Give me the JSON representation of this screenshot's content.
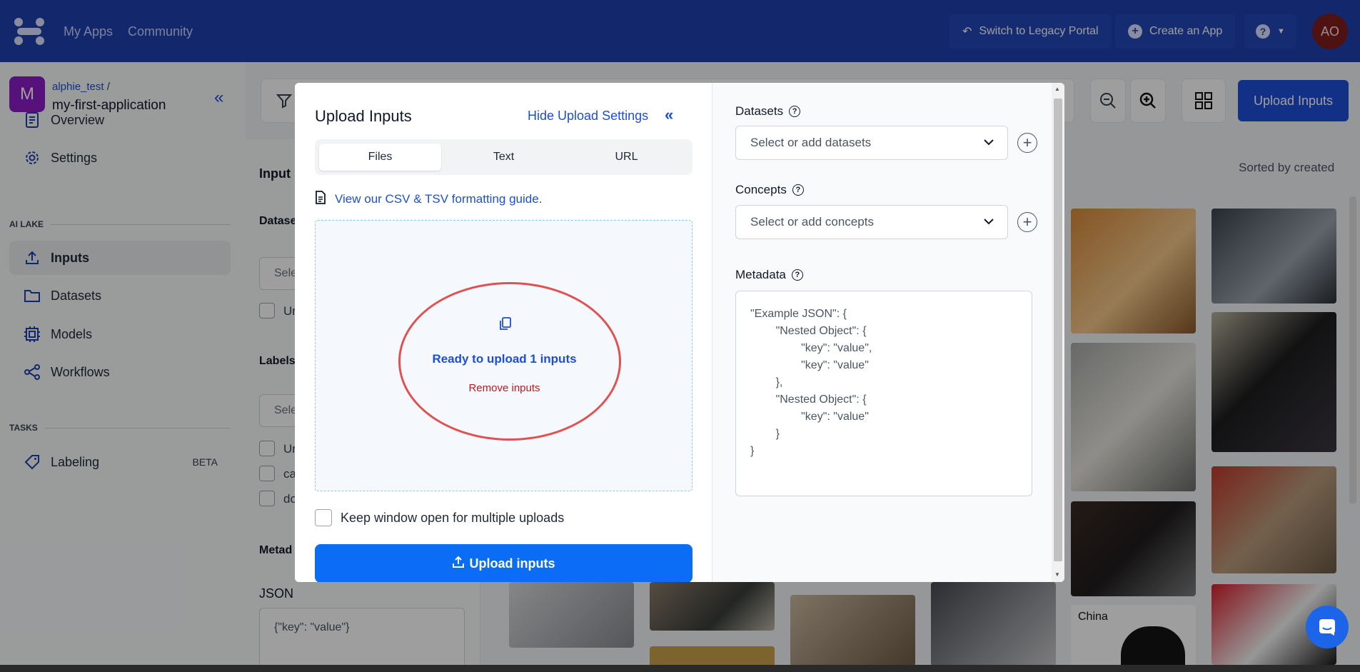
{
  "nav": {
    "links": [
      "My Apps",
      "Community"
    ],
    "legacy_btn": "Switch to Legacy Portal",
    "create_btn": "Create an App",
    "user_initials": "AO"
  },
  "sidebar": {
    "app_initial": "M",
    "user": "alphie_test",
    "separator": "/",
    "app_name": "my-first-application",
    "top_items": [
      {
        "label": "Overview",
        "icon": "document-icon"
      },
      {
        "label": "Settings",
        "icon": "gear-icon"
      }
    ],
    "ai_lake_header": "AI LAKE",
    "ai_lake_items": [
      {
        "label": "Inputs",
        "icon": "upload-icon",
        "active": true
      },
      {
        "label": "Datasets",
        "icon": "folder-icon"
      },
      {
        "label": "Models",
        "icon": "chip-icon"
      },
      {
        "label": "Workflows",
        "icon": "share-nodes-icon"
      }
    ],
    "tasks_header": "TASKS",
    "tasks_items": [
      {
        "label": "Labeling",
        "icon": "tag-icon",
        "badge": "BETA"
      }
    ]
  },
  "background": {
    "upload_inputs_btn": "Upload Inputs",
    "sorted_label": "Sorted by created",
    "filter_labels": [
      "Input",
      "Datase",
      "Labels",
      "Metad"
    ],
    "json_label": "JSON",
    "json_value": "{\"key\": \"value\"}",
    "select_placeholder_frag": "Sele",
    "check_frags": [
      "Ur",
      "Ur",
      "ca",
      "do"
    ],
    "thumb_label": "China"
  },
  "modal": {
    "title": "Upload Inputs",
    "hide_settings": "Hide Upload Settings",
    "tabs": [
      "Files",
      "Text",
      "URL"
    ],
    "active_tab": "Files",
    "guide_link": "View our CSV & TSV formatting guide.",
    "ready_text": "Ready to upload 1 inputs",
    "remove_text": "Remove inputs",
    "keep_open": "Keep window open for multiple uploads",
    "upload_btn": "Upload inputs",
    "datasets_label": "Datasets",
    "datasets_placeholder": "Select or add datasets",
    "concepts_label": "Concepts",
    "concepts_placeholder": "Select or add concepts",
    "metadata_label": "Metadata",
    "metadata_lines": [
      "\"Example JSON\": {",
      "        \"Nested Object\": {",
      "                \"key\": \"value\",",
      "                \"key\": \"value\"",
      "        },",
      "        \"Nested Object\": {",
      "                \"key\": \"value\"",
      "        }",
      "}"
    ]
  },
  "colors": {
    "nav_bg": "#1e40af",
    "accent": "#1d4ed8",
    "primary_btn": "#0b6cf5",
    "annotation_red": "#e05252"
  }
}
